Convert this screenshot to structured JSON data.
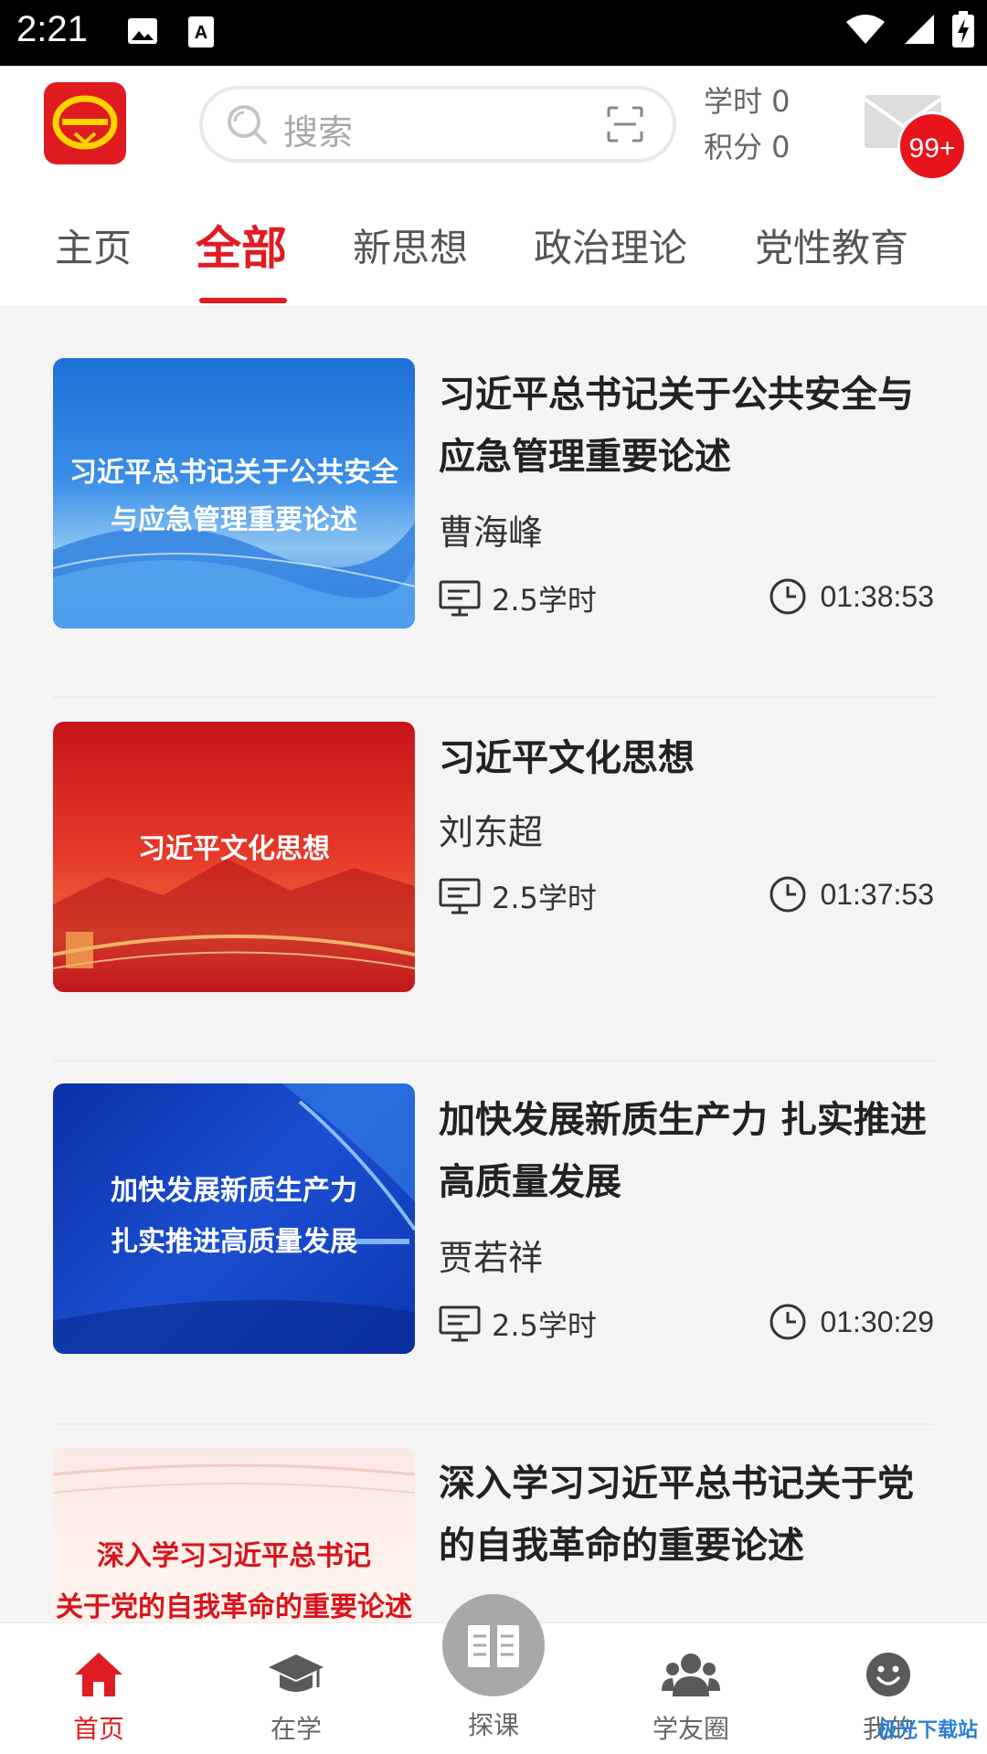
{
  "status": {
    "time": "2:21"
  },
  "header": {
    "search_placeholder": "搜索",
    "study_hours": "学时 0",
    "points": "积分 0",
    "badge": "99+"
  },
  "tabs": [
    {
      "label": "主页"
    },
    {
      "label": "全部"
    },
    {
      "label": "新思想"
    },
    {
      "label": "政治理论"
    },
    {
      "label": "党性教育"
    }
  ],
  "courses": [
    {
      "title": "习近平总书记关于公共安全与应急管理重要论述",
      "thumb_lines": [
        "习近平总书记关于公共安全",
        "与应急管理重要论述"
      ],
      "author": "曹海峰",
      "hours": "2.5学时",
      "duration": "01:38:53"
    },
    {
      "title": "习近平文化思想",
      "thumb_lines": [
        "习近平文化思想"
      ],
      "author": "刘东超",
      "hours": "2.5学时",
      "duration": "01:37:53"
    },
    {
      "title": "加快发展新质生产力 扎实推进高质量发展",
      "thumb_lines": [
        "加快发展新质生产力",
        "扎实推进高质量发展"
      ],
      "author": "贾若祥",
      "hours": "2.5学时",
      "duration": "01:30:29"
    },
    {
      "title": "深入学习习近平总书记关于党的自我革命的重要论述",
      "thumb_lines": [
        "深入学习习近平总书记",
        "关于党的自我革命的重要论述"
      ]
    }
  ],
  "bottom_nav": [
    {
      "label": "首页",
      "icon": "home-icon"
    },
    {
      "label": "在学",
      "icon": "graduation-cap-icon"
    },
    {
      "label": "探课",
      "icon": "book-icon"
    },
    {
      "label": "学友圈",
      "icon": "people-icon"
    },
    {
      "label": "我的",
      "icon": "smiley-icon"
    }
  ],
  "watermark": "极光下载站",
  "colors": {
    "accent": "#e01b22",
    "badge": "#e8141b"
  }
}
